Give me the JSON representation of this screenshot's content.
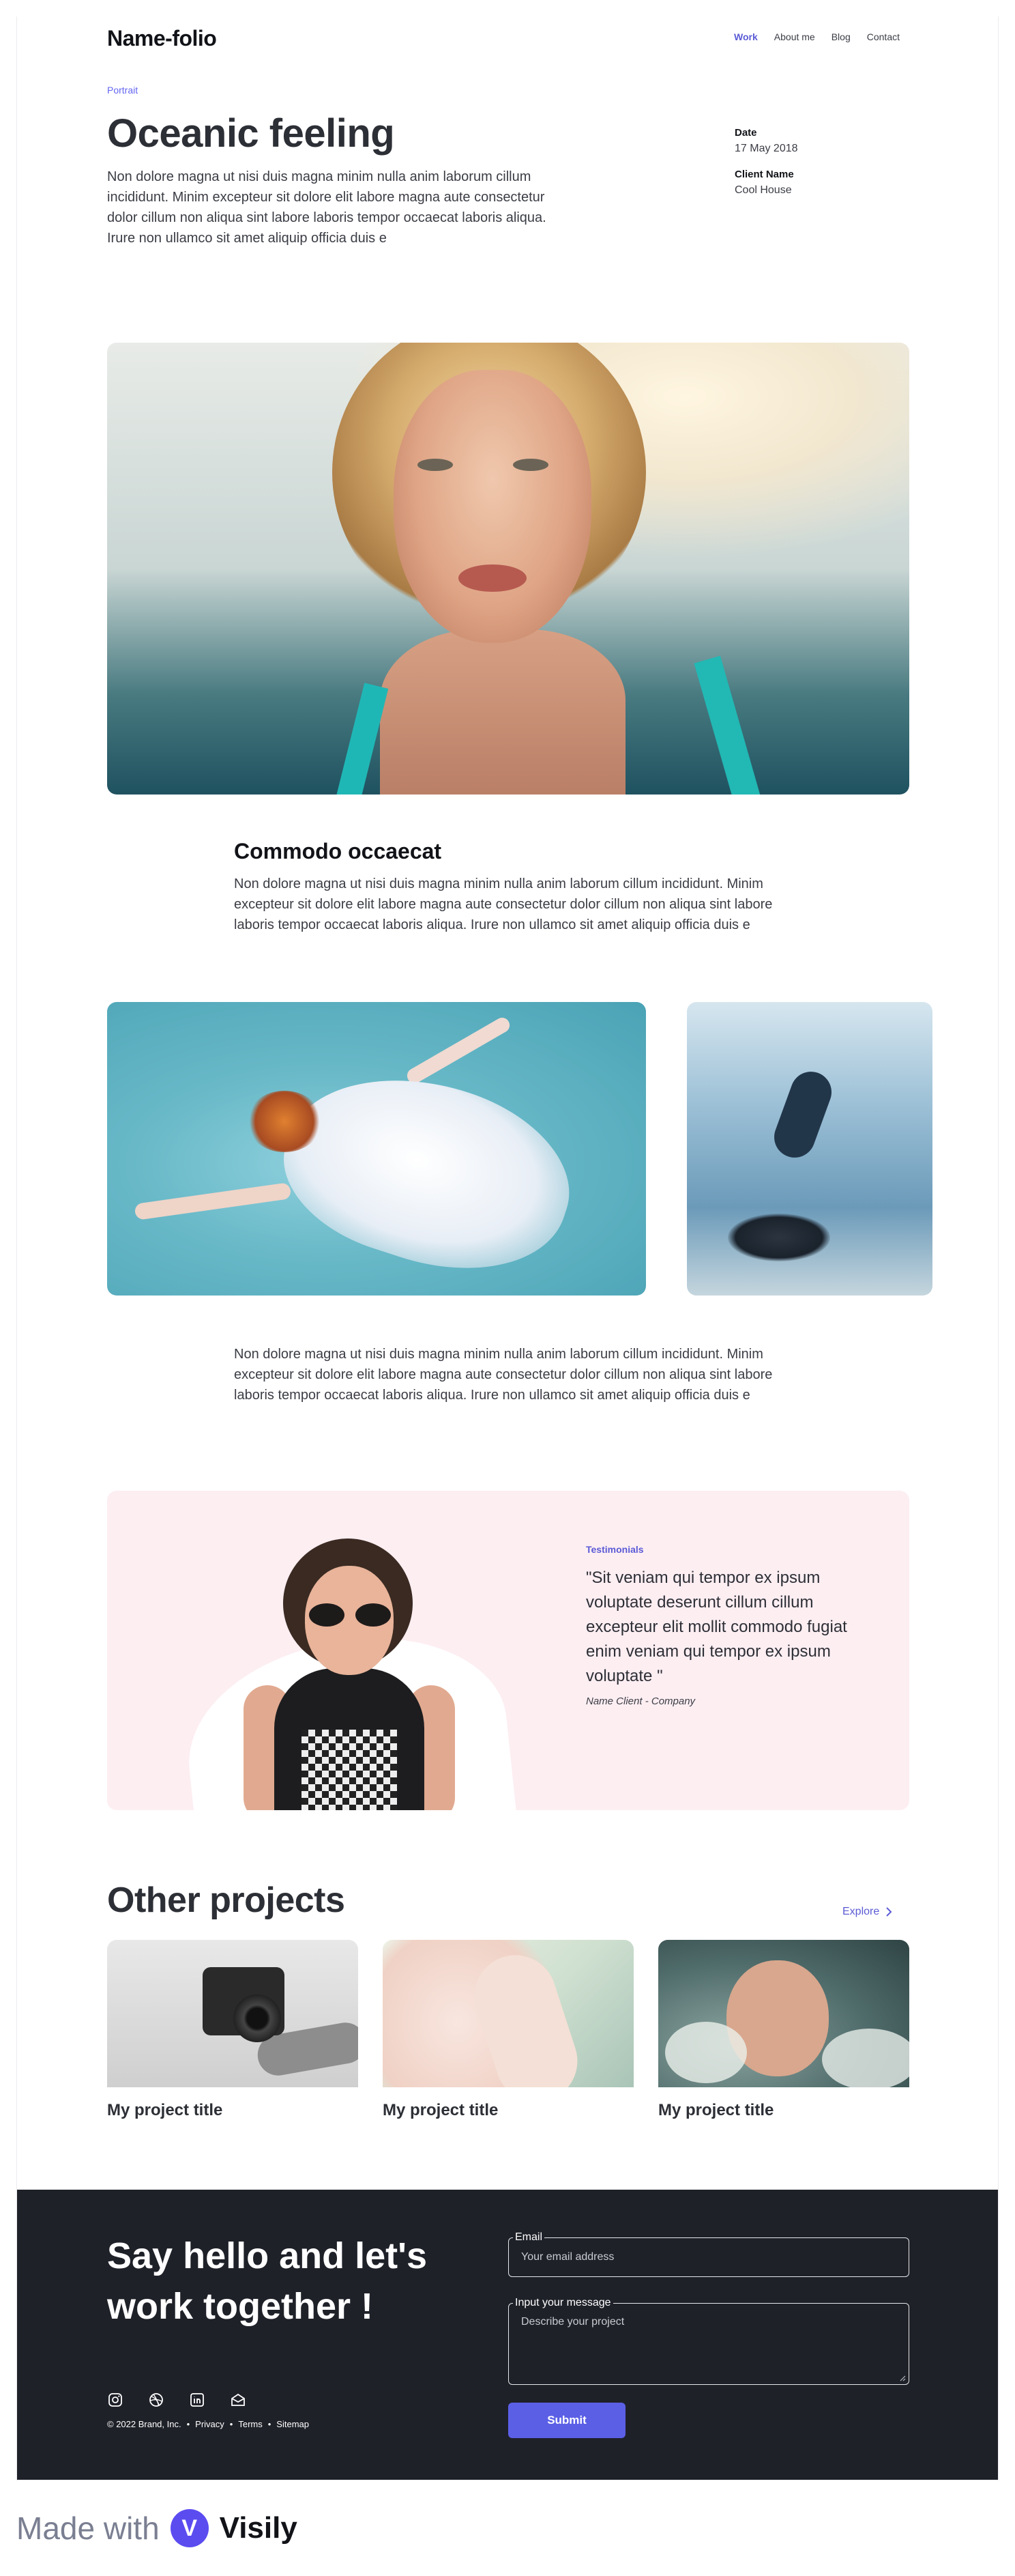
{
  "header": {
    "logo": "Name-folio",
    "nav": [
      "Work",
      "About me",
      "Blog",
      "Contact"
    ]
  },
  "project": {
    "category": "Portrait",
    "title": "Oceanic feeling",
    "intro": "Non dolore magna ut nisi duis magna minim nulla anim laborum cillum incididunt. Minim excepteur sit dolore elit labore magna aute consectetur dolor cillum non aliqua sint labore laboris tempor occaecat laboris aliqua. Irure non ullamco sit amet aliquip officia duis e",
    "date_label": "Date",
    "date_value": "17 May 2018",
    "client_label": "Client Name",
    "client_value": "Cool House"
  },
  "section": {
    "heading": "Commodo occaecat",
    "body1": "Non dolore magna ut nisi duis magna minim nulla anim laborum cillum incididunt. Minim excepteur sit dolore elit labore magna aute consectetur dolor cillum non aliqua sint labore laboris tempor occaecat laboris aliqua. Irure non ullamco sit amet aliquip officia duis e",
    "body2": "Non dolore magna ut nisi duis magna minim nulla anim laborum cillum incididunt. Minim excepteur sit dolore elit labore magna aute consectetur dolor cillum non aliqua sint labore laboris tempor occaecat laboris aliqua. Irure non ullamco sit amet aliquip officia duis e"
  },
  "testimonial": {
    "tag": "Testimonials",
    "quote": "\"Sit veniam qui tempor ex ipsum voluptate deserunt cillum cillum excepteur elit mollit commodo fugiat enim veniam qui tempor ex ipsum voluptate \"",
    "author": "Name Client -  Company"
  },
  "other_projects": {
    "title": "Other projects",
    "explore": "Explore",
    "cards": [
      {
        "title": "My project title"
      },
      {
        "title": "My project title"
      },
      {
        "title": "My project title"
      }
    ]
  },
  "footer": {
    "heading": "Say hello and let's work together !",
    "email_label": "Email",
    "email_placeholder": "Your email address",
    "message_label": "Input your message",
    "message_placeholder": "Describe your project",
    "submit": "Submit",
    "copyright": "© 2022 Brand, Inc.",
    "links": [
      "Privacy",
      "Terms",
      "Sitemap"
    ],
    "socials": [
      "instagram-icon",
      "dribbble-icon",
      "linkedin-icon",
      "mail-icon"
    ]
  },
  "badge": {
    "made_with": "Made with",
    "brand": "Visily"
  },
  "colors": {
    "accent": "#5b5bd6",
    "footer_bg": "#1f2129",
    "testimonial_bg": "#fdeef2",
    "button": "#5b5fe6"
  }
}
